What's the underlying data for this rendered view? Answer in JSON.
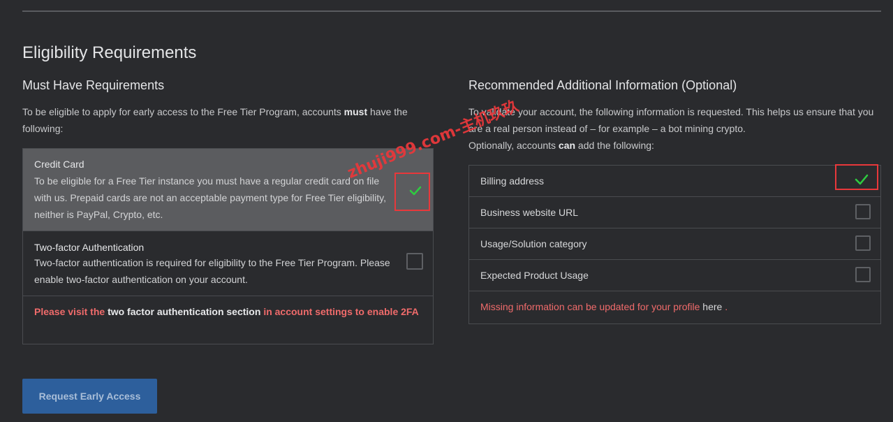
{
  "page": {
    "title": "Eligibility Requirements"
  },
  "must_have": {
    "heading": "Must Have Requirements",
    "desc_prefix": "To be eligible to apply for early access to the Free Tier Program, accounts ",
    "desc_bold": "must",
    "desc_suffix": " have the following:",
    "items": [
      {
        "name": "Credit Card",
        "text": "To be eligible for a Free Tier instance you must have a regular credit card on file with us. Prepaid cards are not an acceptable payment type for Free Tier eligibility, neither is PayPal, Crypto, etc.",
        "checked": true
      },
      {
        "name": "Two-factor Authentication",
        "text": "Two-factor authentication is required for eligibility to the Free Tier Program. Please enable two-factor authentication on your account.",
        "checked": false
      }
    ],
    "warning": {
      "prefix": "Please visit the ",
      "link": " two factor authentication section ",
      "suffix": " in account settings to enable 2FA"
    }
  },
  "optional": {
    "heading": "Recommended Additional Information (Optional)",
    "desc_line1": "To validate your account, the following information is requested. This helps us ensure that you are a real person instead of – for example – a bot mining crypto.",
    "desc_line2_prefix": "Optionally, accounts ",
    "desc_line2_bold": "can",
    "desc_line2_suffix": " add the following:",
    "rows": [
      {
        "label": "Billing address",
        "checked": true
      },
      {
        "label": "Business website URL",
        "checked": false
      },
      {
        "label": "Usage/Solution category",
        "checked": false
      },
      {
        "label": "Expected Product Usage",
        "checked": false
      }
    ],
    "missing_text": "Missing information can be updated for your profile ",
    "missing_link": "here",
    "missing_end": " ."
  },
  "button": {
    "label": "Request Early Access"
  },
  "watermark": "zhuji999.com-主机玖玖",
  "colors": {
    "background": "#2a2b2e",
    "highlight": "#5b5c5f",
    "warning": "#f06b6b",
    "check": "#2ecc40",
    "button": "#2d5f9c",
    "annotation_red": "#e8383b"
  }
}
